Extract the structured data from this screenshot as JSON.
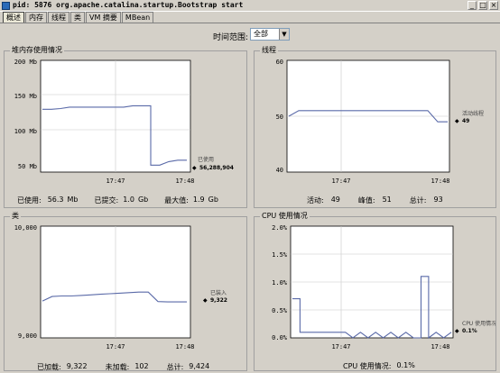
{
  "window": {
    "title": "pid: 5876 org.apache.catalina.startup.Bootstrap start",
    "minimize": "_",
    "maximize": "□",
    "close": "×"
  },
  "tabs": [
    "概述",
    "内存",
    "线程",
    "类",
    "VM 摘要",
    "MBean"
  ],
  "time_range": {
    "label": "时间范围:",
    "value": "全部"
  },
  "panels": {
    "heap": {
      "title": "堆内存使用情况",
      "y_ticks": [
        "200 Mb",
        "150 Mb",
        "100 Mb",
        "50 Mb"
      ],
      "x_ticks": [
        "17:47",
        "17:48"
      ],
      "series_label": "已使用",
      "series_value": "56,288,904",
      "stats": [
        "已使用:",
        "56.3",
        "Mb",
        "已提交:",
        "1.0",
        "Gb",
        "最大值:",
        "1.9",
        "Gb"
      ]
    },
    "threads": {
      "title": "线程",
      "y_ticks": [
        "60",
        "50",
        "40"
      ],
      "x_ticks": [
        "17:47",
        "17:48"
      ],
      "series_label": "活动线程",
      "series_value": "49",
      "stats": [
        "活动:",
        "49",
        "峰值:",
        "51",
        "总计:",
        "93"
      ]
    },
    "classes": {
      "title": "类",
      "y_ticks": [
        "10,000",
        "9,000"
      ],
      "x_ticks": [
        "17:47",
        "17:48"
      ],
      "series_label": "已装入",
      "series_value": "9,322",
      "stats": [
        "已加载:",
        "9,322",
        "未加载:",
        "102",
        "总计:",
        "9,424"
      ]
    },
    "cpu": {
      "title": "CPU 使用情况",
      "y_ticks": [
        "2.0%",
        "1.5%",
        "1.0%",
        "0.5%",
        "0.0%"
      ],
      "x_ticks": [
        "17:47",
        "17:48"
      ],
      "series_label": "CPU 使用情况",
      "series_value": "0.1%",
      "stats": [
        "CPU 使用情况:",
        "0.1%"
      ]
    }
  },
  "chart_data": [
    {
      "type": "line",
      "title": "堆内存使用情况",
      "ylabel": "Mb",
      "ylim": [
        40,
        200
      ],
      "x_ticks": [
        "17:47",
        "17:48"
      ],
      "series": [
        {
          "name": "已使用",
          "values": [
            130,
            130,
            131,
            133,
            133,
            133,
            133,
            133,
            133,
            133,
            135,
            135,
            50,
            50,
            55,
            57,
            57
          ]
        }
      ]
    },
    {
      "type": "line",
      "title": "线程",
      "ylim": [
        40,
        60
      ],
      "x_ticks": [
        "17:47",
        "17:48"
      ],
      "series": [
        {
          "name": "活动线程",
          "values": [
            50,
            51,
            51,
            51,
            51,
            51,
            51,
            51,
            51,
            51,
            51,
            51,
            51,
            51,
            51,
            49,
            49
          ]
        }
      ]
    },
    {
      "type": "line",
      "title": "类",
      "ylim": [
        9000,
        10000
      ],
      "x_ticks": [
        "17:47",
        "17:48"
      ],
      "series": [
        {
          "name": "已装入",
          "values": [
            9330,
            9370,
            9375,
            9375,
            9380,
            9385,
            9390,
            9395,
            9400,
            9405,
            9410,
            9410,
            9325,
            9322,
            9322,
            9322
          ]
        }
      ]
    },
    {
      "type": "line",
      "title": "CPU 使用情况",
      "ylabel": "%",
      "ylim": [
        0,
        2.0
      ],
      "x_ticks": [
        "17:47",
        "17:48"
      ],
      "series": [
        {
          "name": "CPU 使用情况",
          "values": [
            0.7,
            0.1,
            0.1,
            0.1,
            0.1,
            0.1,
            0.1,
            0.1,
            0.0,
            0.1,
            0.0,
            0.1,
            0.0,
            0.1,
            0.0,
            0.1,
            0.0,
            1.1,
            0.0,
            0.1,
            0.0,
            0.1
          ]
        }
      ]
    }
  ]
}
